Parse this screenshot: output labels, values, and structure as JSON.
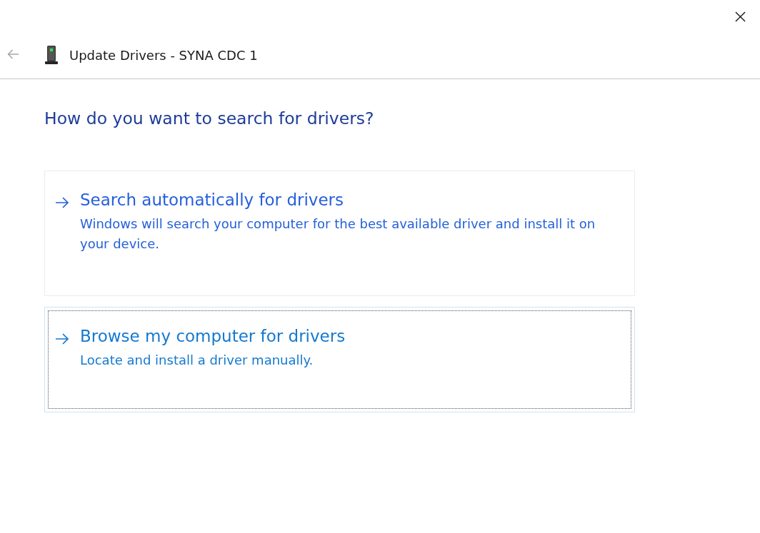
{
  "window": {
    "title": "Update Drivers - SYNA CDC 1"
  },
  "back_button": {
    "disabled": true
  },
  "heading": "How do you want to search for drivers?",
  "options": [
    {
      "title": "Search automatically for drivers",
      "description": "Windows will search your computer for the best available driver and install it on your device.",
      "focused": false
    },
    {
      "title": "Browse my computer for drivers",
      "description": "Locate and install a driver manually.",
      "focused": true
    }
  ]
}
